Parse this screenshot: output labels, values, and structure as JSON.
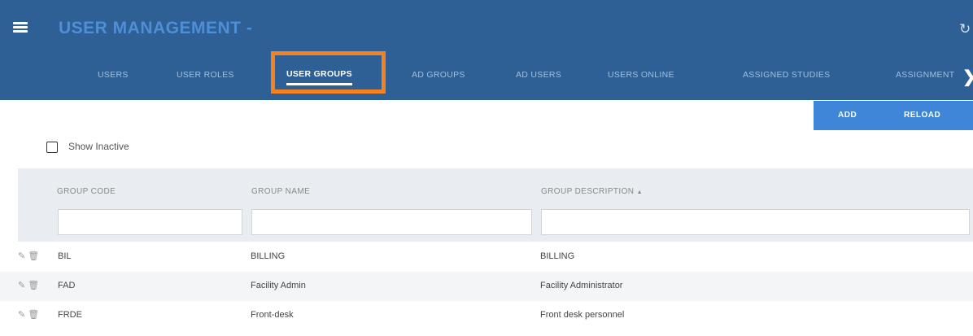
{
  "header": {
    "title": "USER MANAGEMENT",
    "title_suffix": "-",
    "menu_icon": "hamburger-icon",
    "refresh_icon": "refresh-icon"
  },
  "tabs": [
    {
      "label": "USERS"
    },
    {
      "label": "USER ROLES"
    },
    {
      "label": "USER GROUPS"
    },
    {
      "label": "AD GROUPS"
    },
    {
      "label": "AD USERS"
    },
    {
      "label": "USERS ONLINE"
    },
    {
      "label": "ASSIGNED STUDIES"
    },
    {
      "label": "ASSIGNMENT"
    }
  ],
  "active_tab": "USER GROUPS",
  "highlight_color": "#f58220",
  "accent_color": "#2e5f95",
  "button_color": "#3f86d8",
  "toolbar": {
    "add_label": "ADD",
    "reload_label": "RELOAD"
  },
  "filter_bar": {
    "show_inactive_label": "Show Inactive",
    "show_inactive_checked": false
  },
  "table": {
    "columns": [
      "GROUP CODE",
      "GROUP NAME",
      "GROUP DESCRIPTION"
    ],
    "sort_indicator": "▲",
    "rows": [
      {
        "code": "BIL",
        "name": "BILLING",
        "description": "BILLING"
      },
      {
        "code": "FAD",
        "name": "Facility Admin",
        "description": "Facility Administrator"
      },
      {
        "code": "FRDE",
        "name": "Front-desk",
        "description": "Front desk personnel"
      }
    ]
  }
}
